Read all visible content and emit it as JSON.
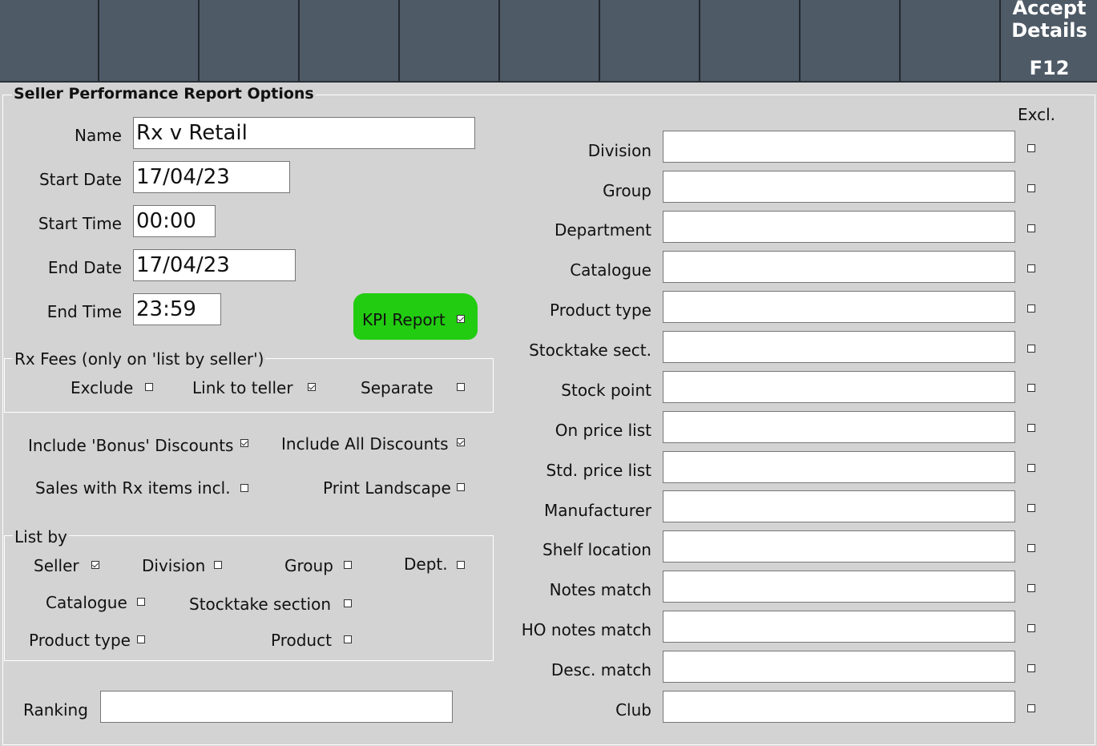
{
  "toolbar": {
    "accept_line1": "Accept",
    "accept_line2": "Details",
    "accept_key": "F12"
  },
  "form": {
    "title": "Seller Performance Report Options",
    "name_label": "Name",
    "name_value": "Rx v Retail",
    "start_date_label": "Start Date",
    "start_date_value": "17/04/23",
    "start_time_label": "Start Time",
    "start_time_value": "00:00",
    "end_date_label": "End Date",
    "end_date_value": "17/04/23",
    "end_time_label": "End Time",
    "end_time_value": "23:59",
    "kpi_label": "KPI Report",
    "kpi_checked": true
  },
  "rx_fees": {
    "title": "Rx Fees (only on 'list by seller')",
    "exclude_label": "Exclude",
    "link_label": "Link to teller",
    "separate_label": "Separate"
  },
  "options": {
    "bonus_label": "Include 'Bonus' Discounts",
    "all_discounts_label": "Include All Discounts",
    "rx_items_label": "Sales with Rx items incl.",
    "landscape_label": "Print Landscape"
  },
  "list_by": {
    "title": "List by",
    "seller": "Seller",
    "division": "Division",
    "group": "Group",
    "dept": "Dept.",
    "catalogue": "Catalogue",
    "stocktake": "Stocktake section",
    "product_type": "Product type",
    "product": "Product"
  },
  "ranking": {
    "label": "Ranking",
    "value": ""
  },
  "filters": {
    "excl_header": "Excl.",
    "items": [
      {
        "label": "Division",
        "value": ""
      },
      {
        "label": "Group",
        "value": ""
      },
      {
        "label": "Department",
        "value": ""
      },
      {
        "label": "Catalogue",
        "value": ""
      },
      {
        "label": "Product type",
        "value": ""
      },
      {
        "label": "Stocktake sect.",
        "value": ""
      },
      {
        "label": "Stock point",
        "value": ""
      },
      {
        "label": "On price list",
        "value": ""
      },
      {
        "label": "Std. price list",
        "value": ""
      },
      {
        "label": "Manufacturer",
        "value": ""
      },
      {
        "label": "Shelf location",
        "value": ""
      },
      {
        "label": "Notes match",
        "value": ""
      },
      {
        "label": "HO notes match",
        "value": ""
      },
      {
        "label": "Desc. match",
        "value": ""
      },
      {
        "label": "Club",
        "value": ""
      }
    ]
  },
  "colors": {
    "toolbar": "#4e5a66",
    "background": "#d3d3d3",
    "kpi_highlight": "#22cc11"
  }
}
